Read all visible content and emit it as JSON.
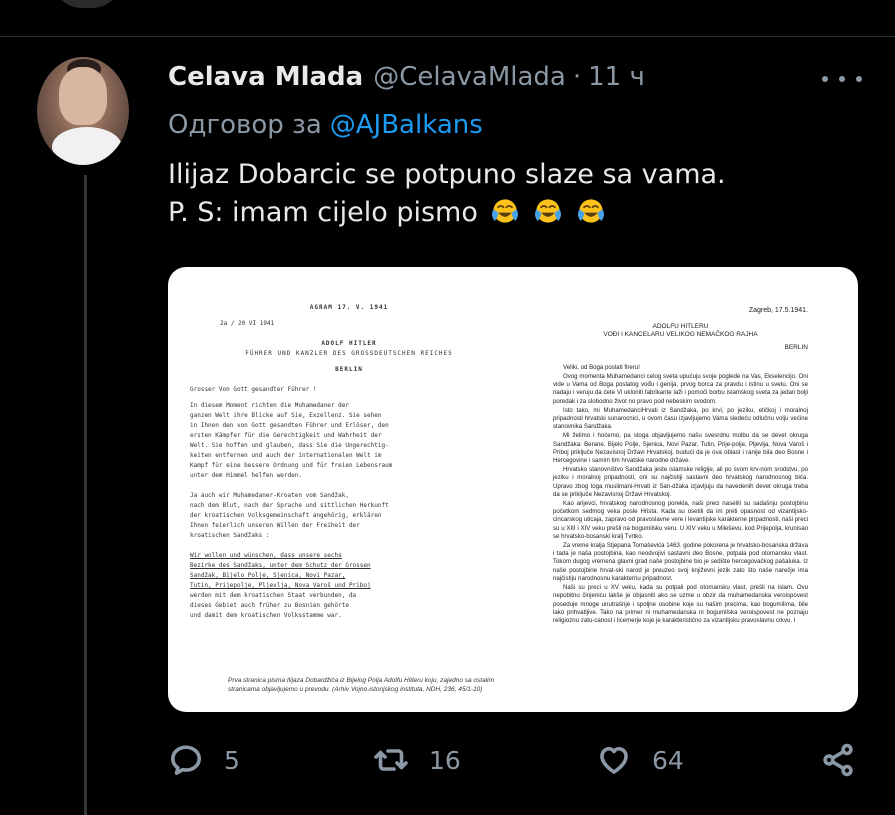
{
  "tweet": {
    "display_name": "Celava Mlada",
    "handle": "@CelavaMlada",
    "separator": "·",
    "time": "11 ч",
    "reply_prefix": "Одговор за",
    "reply_to": "@AJBalkans",
    "text_line1": "Ilijaz Dobarcic se potpuno slaze sa vama.",
    "text_line2": "P. S: imam cijelo pismo",
    "emoji_name": "face-with-tears-of-joy"
  },
  "media": {
    "left_page": {
      "heading_place": "AGRAM 17. V. 1941",
      "line_date": "2a / 20 VI 1941",
      "addressee": "ADOLF HITLER",
      "subtitle": "FÜHRER UND KANZLER DES GROSSDEUTSCHEN REICHES",
      "city": "BERLIN",
      "salutation": "Grosser Von Gott gesandter Führer !",
      "body": [
        "In diesem Moment richten die Muhamedaner der",
        "ganzen Welt ihre Blicke auf Sie, Exzellenz. Sie sehen",
        "in Ihnen den von Gott gesandten Führer und Erlöser, den",
        "ersten Kämpfer für die Gerechtigkeit und Wahrheit der",
        "Welt. Sie hoffen und glauben, dass Sie die Ungerechtig-",
        "keiten entfernen und auch der internationalen Welt im",
        "Kampf für eine bessere Ordnung und für freien Lebensraum",
        "unter dem Himmel helfen werden.",
        "",
        "Ja auch wir Muhamedaner-Kroaten vom Sandžak,",
        "nach dem Blut, nach der Sprache und sittlichen Herkunft",
        "der kroatischen Volksgemeinschaft angehörig, erklären",
        "Ihnen feierlich unseren Willen der Freiheit der",
        "kroatischen Sandžaks :",
        "",
        "Wir wollen und wünschen, dass unsere sechs",
        "Bezirke des Sandžaks, unter dem Schutz der Grossen",
        "Sandžak, Bijelo Polje, Sjenica, Novi Pazar,",
        "Tutin, Prijepolje, Pljevlja, Nova Varoš und Priboj",
        "werden mit dem kroatischen Staat verbunden, da",
        "dieses Gebiet auch früher zu Bosnien gehörte",
        "und damit dem kroatischen Volksstamme war."
      ],
      "caption": "Prva stranica pisma Ilijaza Dobardžića iz Bijelog Polja Adolfu Hitleru koju, zajedno sa ostalim stranicama objavljujemo u prevodu. (Arhiv Vojno-istorijskog instituta, NDH, 236, 45/1-10)"
    },
    "right_page": {
      "date": "Zagreb, 17.5.1941.",
      "addressee": "ADOLFU HITLERU",
      "title": "VOĐI I KANCELARU VELIKOG NEMAČKOG RAJHA",
      "city": "BERLIN",
      "salutation": "Veliki, od Boga poslati fireru!",
      "paragraphs": [
        "Ovog momenta Muhamedanci celog sveta upućuju svoje poglede na Vas, Ekselencijo. Oni vide u Vama od Boga poslatog vođu i genija, prvog borca za pravdu i istinu u svetu. Oni se nadaju i veruju da ćete Vi ukloniti fabrikante laži i pomoći borbu islamskog sveta za jedan bolji poredak i za slobodno život no pravo pod nebeskim svodom.",
        "Isto tako, mi MuhamedanciHrvati iz Sandžaka, po krvi, po jeziku, etičkoj i moralnoj pripadnosti hrvatski sunarocnici, u ovom času izjavljujemo Vama sledeću odlučnu volju većine stanovnika Sandžaka.",
        "Mi želimo i hoćemo, pa stoga objavljujemo našu svesrdnu molbu da se devet okruga Sandžaka: Berane, Bijelo Polje, Sjenica, Novi Pazar, Tutin, Prije-polje, Pljevlja, Nova Varoš i Priboj priključe Nezavisnoj Državi Hrvatskoj, budući da je ova oblast i ranije bila deo Bosne i Hercegovine i samim tim hrvatske narodne države.",
        "Hrvatsko stanovništvo Sandžaka jeste islamske religije, ali po svom krv-nom srodstvu, po jeziku i moralnoj pripadnosti, oni su najčistiji sastavni deo hrvatskog narodnosnog bića. Upravo zbog toga muslimani-Hrvati iz San-džaka izjavljuju da navedenih devet okruga treba da se priključe Nezavisnoj Državi Hrvatskoj.",
        "Kao arijevci, hrvatskog narodnosnog porekla, naši preci naselili su sadašnju postojbinu početkom sedmog veka posle Hrista. Kada su osetili da im preti opasnost od vizantijsko-cincarskog uticaja, zapravo od pravoslavne vere i levantijske karakterne pripadnosti, naši preci su u XIII i XIV veku prešli na bogumilsku veru. U XIV veku u Mileševu, kod Prijepolja, krunisao se hrvatsko-bosanski kralj Tvrtko.",
        "Za vreme kralja Stjepana Tomaševića 1463. godine pokorena je hrvatsko-bosanska država i tada je naša postojbina, kao neodvojivi sastavni deo Bosne, potpala pod otomansku vlast. Tokom dugog vremena glavni grad naše postojbine bio je sedište hercegovačkog pašaluka. Iz naše postojbine hrvat-ski narod je preuzeo svoj književni jezik zato što naše narečje ima najčistiju narodnosnu karakternu pripadnost.",
        "Naši su preci u XV veku, kada su potpali pod otomansku vlast, prešli na islam. Ovu nepobitnu činjenicu lakše je objasniti ako se uzme u obzir da muhamedanska veroispovest poseduje mnoge unutrašnje i spoljne osobine koje su našim precima, kao bogumilima, bile lako prihvatljive. Tako na primer ni muhamedanska ni bogumilska veroispovest ne poznaju religioznu zatu-canost i licemerje koje je karakteristično za vizantijsku pravoslavnu crkvu. I"
      ]
    }
  },
  "actions": {
    "reply_count": "5",
    "retweet_count": "16",
    "like_count": "64"
  },
  "icons": {
    "reply": "speech-bubble-icon",
    "retweet": "retweet-icon",
    "like": "heart-icon",
    "share": "share-icon",
    "more": "more-dots-icon"
  },
  "colors": {
    "background": "#000000",
    "text": "#e7e9ea",
    "secondary": "#8b98a5",
    "link": "#1d9bf0"
  }
}
